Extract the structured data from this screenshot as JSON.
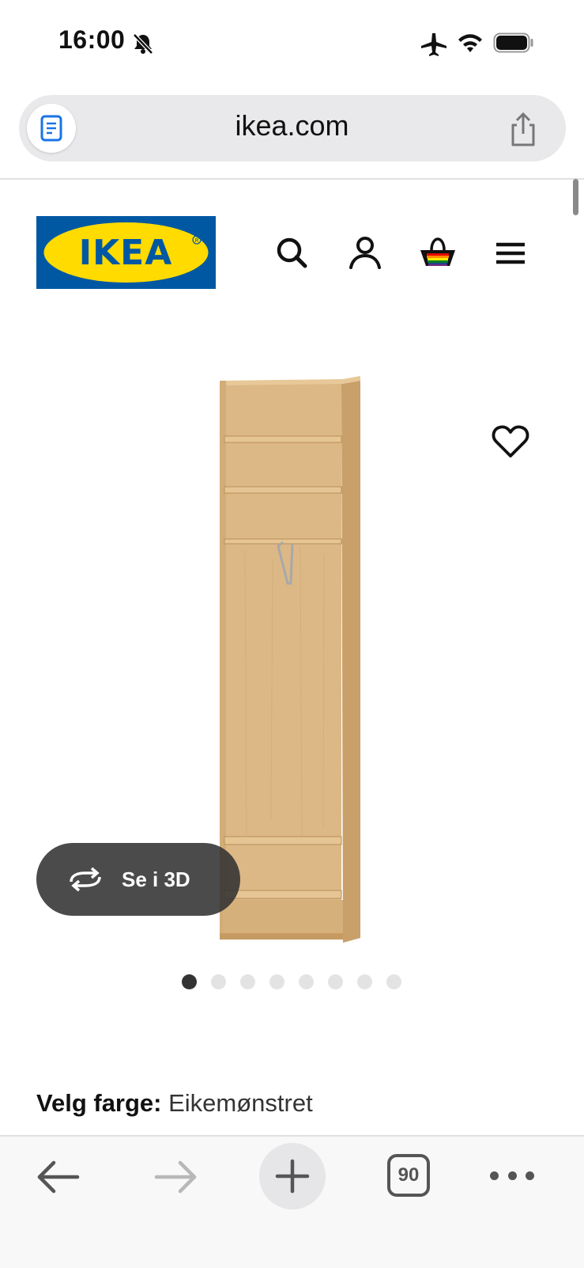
{
  "status_bar": {
    "time": "16:00"
  },
  "browser": {
    "url": "ikea.com",
    "open_tabs": "90"
  },
  "header": {
    "logo_text": "IKEA"
  },
  "product": {
    "view_3d_label": "Se i 3D",
    "image_count": 8,
    "active_image_index": 0
  },
  "colour": {
    "label": "Velg farge:",
    "value": "Eikemønstret"
  },
  "colors": {
    "ikea_blue": "#0058a3",
    "ikea_yellow": "#ffdb00",
    "wood": "#d9b27a"
  },
  "icons": [
    "bell-slash-icon",
    "airplane-icon",
    "wifi-icon",
    "battery-icon",
    "reader-icon",
    "share-icon",
    "search-icon",
    "account-icon",
    "basket-icon",
    "menu-icon",
    "heart-icon",
    "rotate-3d-icon",
    "back-arrow-icon",
    "forward-arrow-icon",
    "plus-icon",
    "more-icon"
  ]
}
